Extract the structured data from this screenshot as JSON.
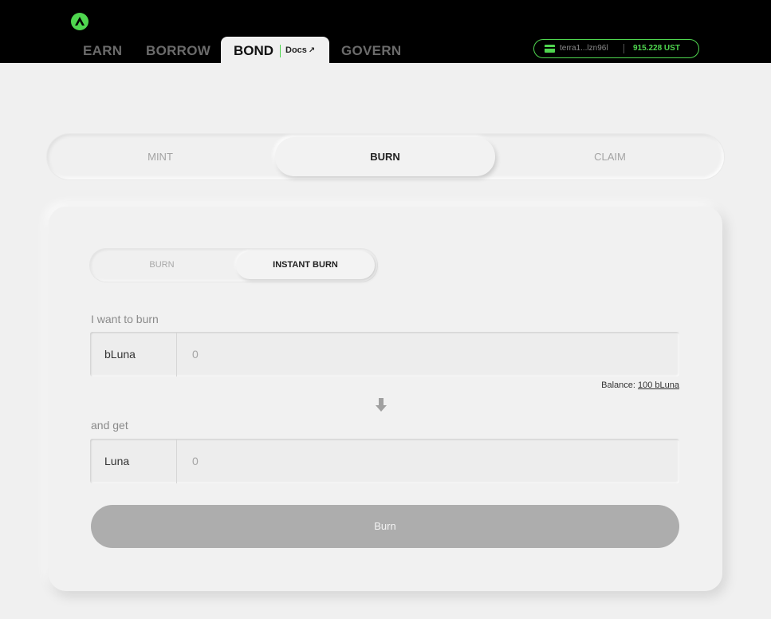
{
  "header": {
    "nav": {
      "earn": "EARN",
      "borrow": "BORROW",
      "bond": "BOND",
      "docs": "Docs",
      "govern": "GOVERN"
    },
    "wallet": {
      "address": "terra1...lzn96l",
      "balance": "915.228 UST"
    }
  },
  "main_tabs": [
    "MINT",
    "BURN",
    "CLAIM"
  ],
  "active_main_tab": "BURN",
  "card": {
    "sub_tabs": [
      "BURN",
      "INSTANT BURN"
    ],
    "active_sub_tab": "INSTANT BURN",
    "burn_label": "I want to burn",
    "burn_unit": "bLuna",
    "burn_placeholder": "0",
    "balance_label": "Balance:",
    "balance_value": "100 bLuna",
    "get_label": "and get",
    "get_unit": "Luna",
    "get_placeholder": "0",
    "submit_label": "Burn"
  },
  "colors": {
    "accent": "#4fd64f",
    "background": "#f0f0f0",
    "topbar": "#000000",
    "button_disabled": "#adadad"
  },
  "icons": {
    "logo": "anchor-logo-icon",
    "docs_external": "external-link-icon",
    "wallet": "wallet-icon",
    "arrow": "arrow-down-icon"
  }
}
